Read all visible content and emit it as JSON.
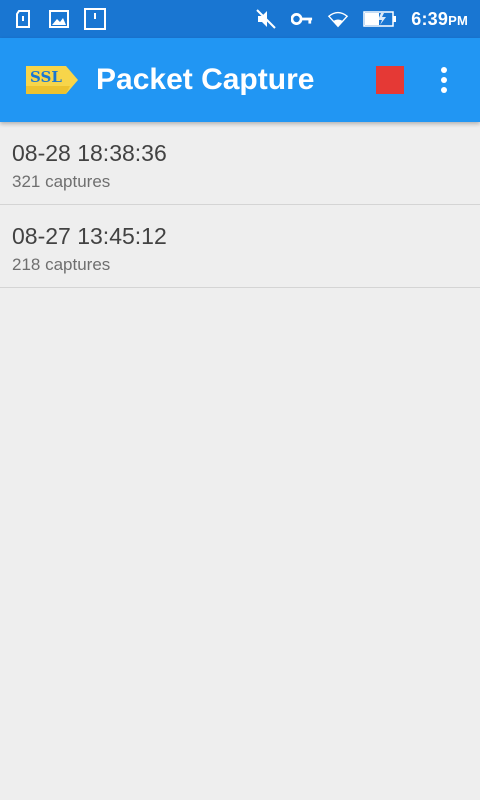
{
  "status_bar": {
    "time": "6:39",
    "ampm": "PM",
    "icons": [
      "sd-card-icon",
      "image-icon",
      "alert-icon",
      "mute-icon",
      "vpn-key-icon",
      "wifi-icon",
      "battery-icon"
    ]
  },
  "app_bar": {
    "title": "Packet Capture",
    "logo_text": "SSL",
    "logo_colors": {
      "badge": "#f7d54a",
      "text": "#1976d2"
    },
    "stop_color": "#e53935"
  },
  "captures": [
    {
      "title": "08-28 18:38:36",
      "subtitle": "321 captures"
    },
    {
      "title": "08-27 13:45:12",
      "subtitle": "218 captures"
    }
  ]
}
